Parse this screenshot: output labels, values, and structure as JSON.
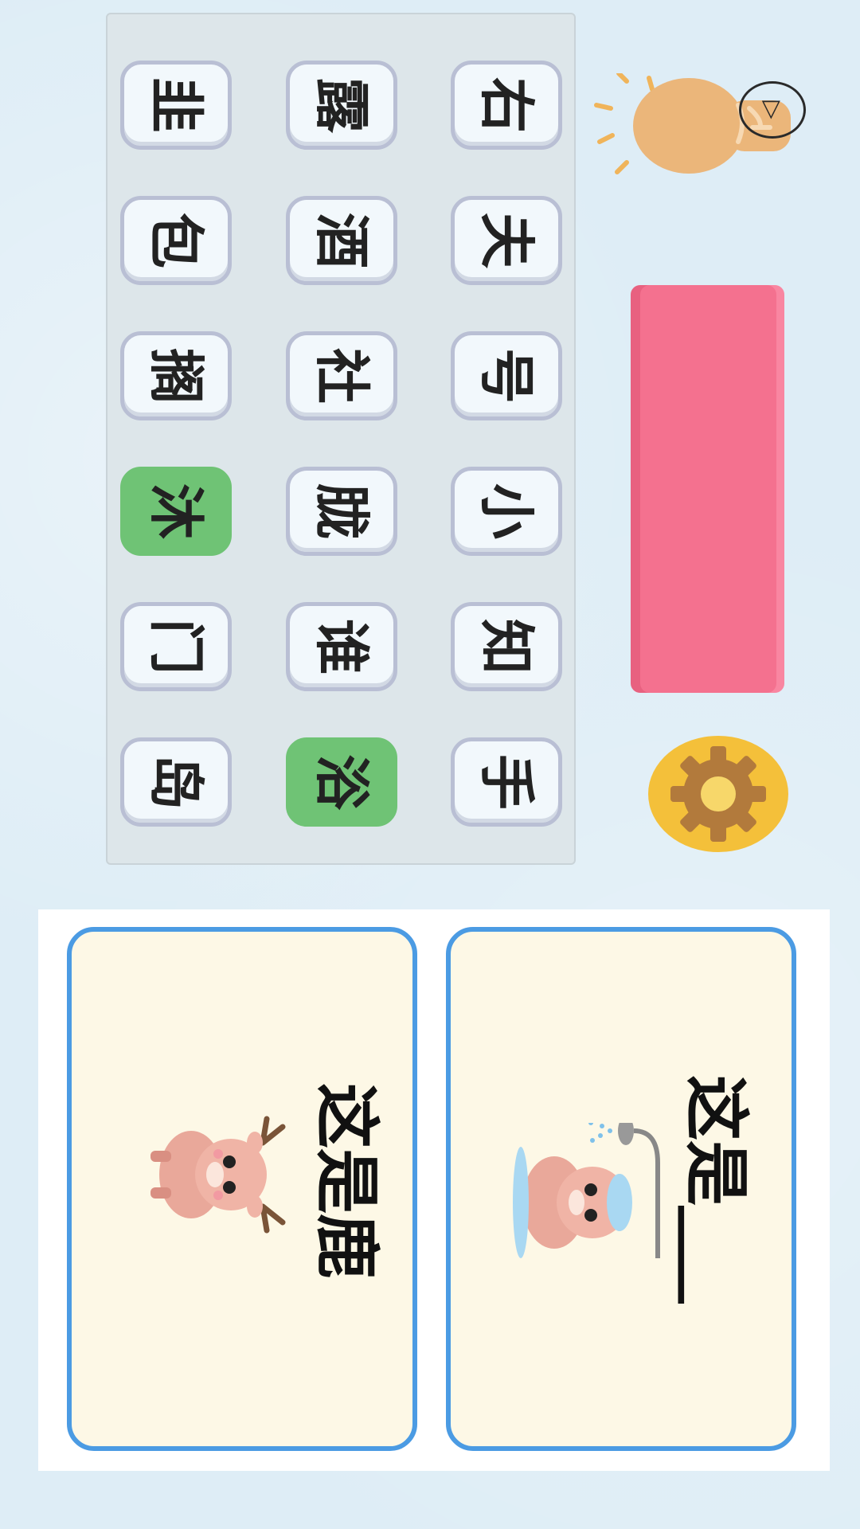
{
  "grid": {
    "rows": [
      [
        "韭",
        "露",
        "右"
      ],
      [
        "包",
        "酒",
        "夫"
      ],
      [
        "搁",
        "社",
        "号"
      ],
      [
        "沐",
        "胧",
        "小"
      ],
      [
        "门",
        "谁",
        "知"
      ],
      [
        "岛",
        "浴",
        "手"
      ]
    ],
    "matched": [
      "沐",
      "浴"
    ]
  },
  "hint": {
    "badge_text": "▷",
    "icon": "lightbulb-icon"
  },
  "progress": {
    "color": "#f4718f"
  },
  "settings": {
    "icon": "gear-icon"
  },
  "cards": {
    "left": {
      "text": "这是鹿",
      "icon": "deer-icon"
    },
    "right": {
      "text": "这是___",
      "icon": "deer-shower-icon"
    }
  },
  "colors": {
    "matched_tile": "#6fc375",
    "card_border": "#4b9be3",
    "card_bg": "#fdf8e6"
  }
}
